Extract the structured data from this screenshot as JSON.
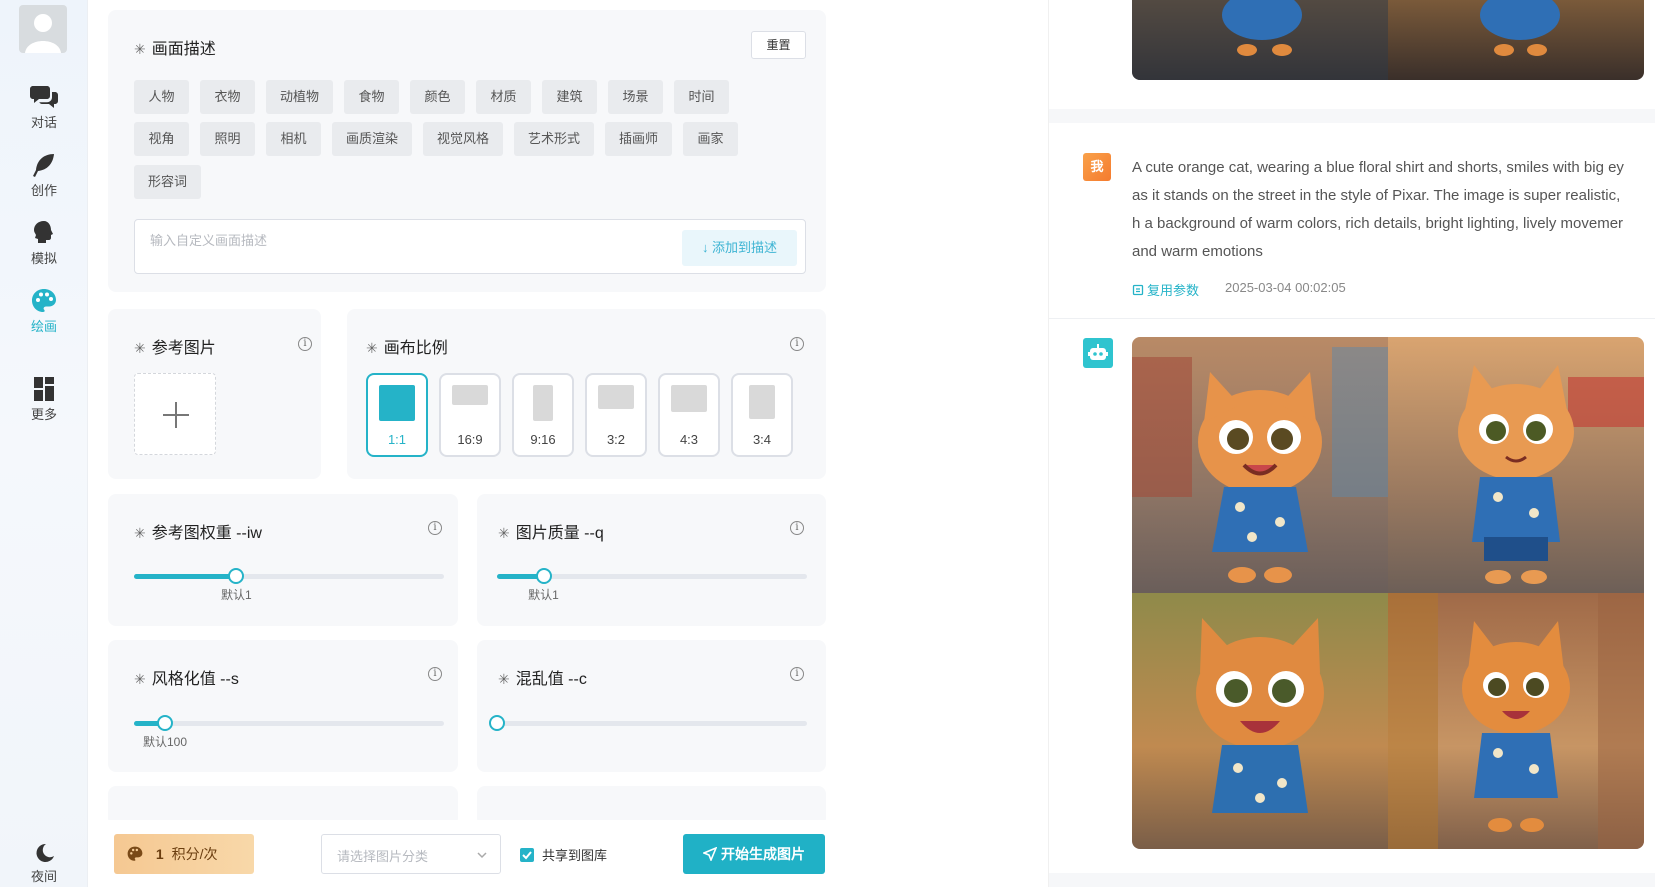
{
  "sidebar": {
    "items": [
      {
        "label": "对话",
        "icon": "chat-bubbles-icon"
      },
      {
        "label": "创作",
        "icon": "feather-icon"
      },
      {
        "label": "模拟",
        "icon": "head-silhouette-icon"
      },
      {
        "label": "绘画",
        "icon": "palette-icon"
      },
      {
        "label": "更多",
        "icon": "grid-icon"
      }
    ],
    "active": "绘画",
    "night_label": "夜间"
  },
  "description": {
    "title": "画面描述",
    "reset_label": "重置",
    "tags_row1": [
      "人物",
      "衣物",
      "动植物",
      "食物",
      "颜色",
      "材质",
      "建筑",
      "场景",
      "时间"
    ],
    "tags_row2": [
      "视角",
      "照明",
      "相机",
      "画质渲染",
      "视觉风格",
      "艺术形式",
      "插画师",
      "画家"
    ],
    "tags_row3": [
      "形容词"
    ],
    "input_placeholder": "输入自定义画面描述",
    "add_label": "↓ 添加到描述"
  },
  "reference": {
    "title": "参考图片"
  },
  "canvas": {
    "title": "画布比例",
    "ratios": [
      "1:1",
      "16:9",
      "9:16",
      "3:2",
      "4:3",
      "3:4"
    ],
    "selected": "1:1"
  },
  "params": {
    "iw": {
      "title": "参考图权重 --iw",
      "default_label": "默认1",
      "value_fraction": 0.33
    },
    "q": {
      "title": "图片质量 --q",
      "default_label": "默认1",
      "value_fraction": 0.15
    },
    "s": {
      "title": "风格化值 --s",
      "default_label": "默认100",
      "value_fraction": 0.1
    },
    "c": {
      "title": "混乱值 --c",
      "value_fraction": 0.0
    }
  },
  "bottom": {
    "points_value": "1",
    "points_unit": "积分/次",
    "category_placeholder": "请选择图片分类",
    "share_label": "共享到图库",
    "share_checked": true,
    "generate_label": "开始生成图片"
  },
  "chat": {
    "me_avatar": "我",
    "prompt_lines": [
      "A cute orange cat, wearing a blue floral shirt and shorts, smiles with big ey",
      "as it stands on the street in the style of Pixar. The image is super realistic,",
      "h a background of warm colors, rich details, bright lighting, lively movemer",
      "and warm emotions"
    ],
    "copy_label": "复用参数",
    "timestamp": "2025-03-04 00:02:05"
  },
  "colors": {
    "accent": "#25b3c8",
    "points_bg": "#f6cd98"
  }
}
